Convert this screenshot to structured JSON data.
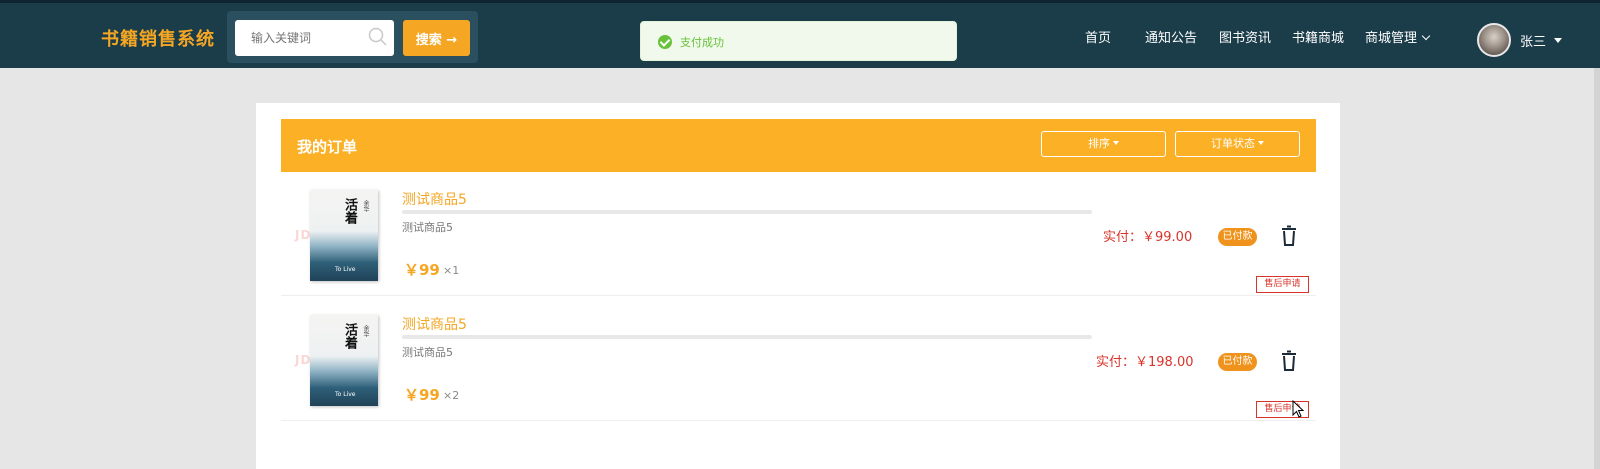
{
  "header": {
    "brand": "书籍销售系统",
    "search": {
      "placeholder": "输入关键词",
      "button_label": "搜索 →"
    },
    "toast": {
      "message": "支付成功"
    },
    "nav": [
      {
        "label": "首页"
      },
      {
        "label": "通知公告"
      },
      {
        "label": "图书资讯"
      },
      {
        "label": "书籍商城"
      },
      {
        "label": "商城管理"
      }
    ],
    "user": {
      "name": "张三"
    }
  },
  "orders": {
    "title": "我的订单",
    "sort_label": "排序",
    "status_filter_label": "订单状态",
    "items": [
      {
        "name": "测试商品5",
        "desc": "测试商品5",
        "price": "￥99",
        "qty": "×1",
        "paid_total": "实付：￥99.00",
        "status": "已付款",
        "after_sale": "售后申请",
        "cover": {
          "title": "活着",
          "author": "余华",
          "en": "To Live"
        },
        "watermark": "JD"
      },
      {
        "name": "测试商品5",
        "desc": "测试商品5",
        "price": "￥99",
        "qty": "×2",
        "paid_total": "实付：￥198.00",
        "status": "已付款",
        "after_sale": "售后申请",
        "cover": {
          "title": "活着",
          "author": "余华",
          "en": "To Live"
        },
        "watermark": "JD"
      }
    ]
  },
  "colors": {
    "header_bg": "#1b3d4a",
    "accent": "#f5a623",
    "order_header": "#fbb026",
    "price_red": "#d9342a",
    "success_green": "#67c23a"
  }
}
